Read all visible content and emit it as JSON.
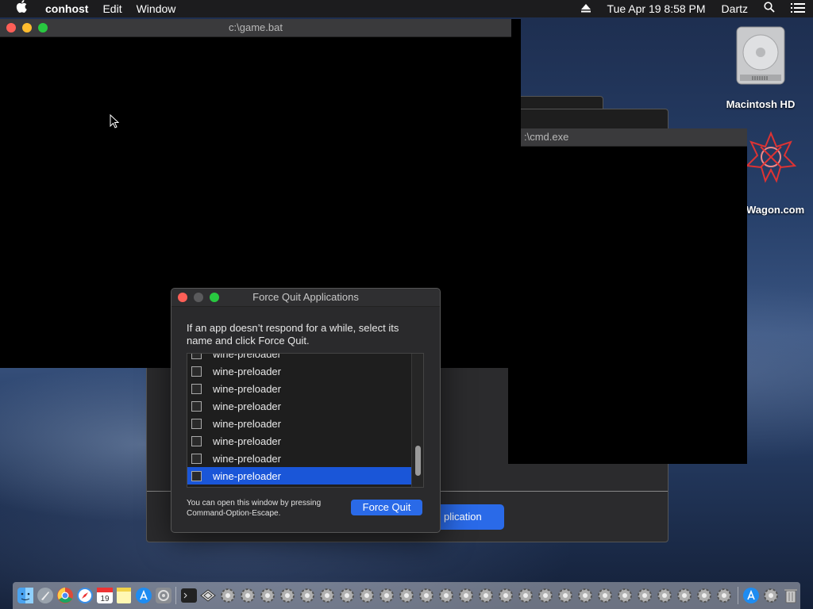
{
  "menubar": {
    "apple": "",
    "app": "conhost",
    "menus": [
      "Edit",
      "Window"
    ],
    "date_time": "Tue Apr 19  8:58 PM",
    "user": "Dartz"
  },
  "windows": {
    "game": {
      "title": "c:\\game.bat"
    },
    "cmd": {
      "title": ":\\cmd.exe"
    },
    "partial_button": "plication"
  },
  "force_quit": {
    "title": "Force Quit Applications",
    "message": "If an app doesn’t respond for a while, select its name and click Force Quit.",
    "apps": [
      "wine-preloader",
      "wine-preloader",
      "wine-preloader",
      "wine-preloader",
      "wine-preloader",
      "wine-preloader",
      "wine-preloader",
      "wine-preloader"
    ],
    "selected_index": 7,
    "hint": "You can open this window by pressing Command-Option-Escape.",
    "button": "Force Quit"
  },
  "desktop": {
    "icons": [
      {
        "label": "Macintosh HD",
        "icon": "hard-drive-icon"
      },
      {
        "label": "Wagon.com",
        "icon": "snowflake-icon"
      }
    ]
  },
  "dock": {
    "icons": [
      "finder-icon",
      "launchpad-icon",
      "chrome-icon",
      "safari-icon",
      "calendar-icon",
      "notes-icon",
      "app-store-icon",
      "system-preferences-icon",
      "terminal-icon",
      "wine-icon",
      "gear-icon",
      "gear-icon",
      "gear-icon",
      "gear-icon",
      "gear-icon",
      "gear-icon",
      "gear-icon",
      "gear-icon",
      "gear-icon",
      "gear-icon",
      "gear-icon",
      "gear-icon",
      "gear-icon",
      "gear-icon",
      "gear-icon",
      "gear-icon",
      "gear-icon",
      "gear-icon",
      "gear-icon",
      "gear-icon",
      "gear-icon",
      "gear-icon",
      "gear-icon",
      "gear-icon",
      "gear-icon",
      "gear-icon",
      "downloads-app-store-icon",
      "gear-icon",
      "trash-icon"
    ],
    "calendar_day": "19"
  }
}
